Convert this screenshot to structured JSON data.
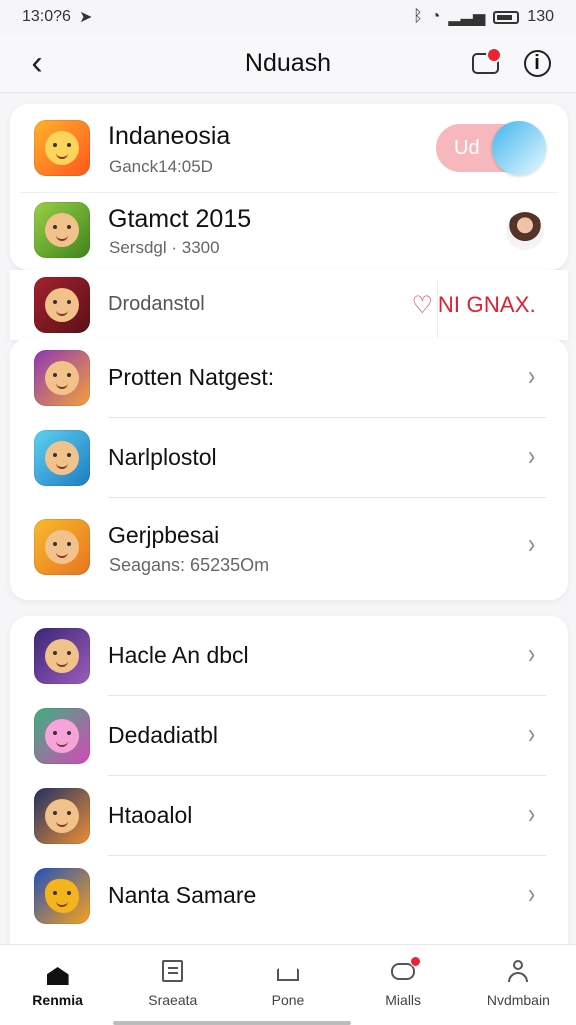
{
  "status_bar": {
    "time": "13:0?6",
    "right_time": "130"
  },
  "header": {
    "title": "Nduash"
  },
  "featured": [
    {
      "title": "Indaneosia",
      "subtitle": "Ganck14:05D",
      "pill": "Ud"
    },
    {
      "title": "Gtamct 2015",
      "subtitle": "Sersdgl · 3300"
    },
    {
      "title": "Drodanstol",
      "promo": "NI GNAX."
    }
  ],
  "card_one": [
    {
      "title": "Protten Natgest:"
    },
    {
      "title": "Narlplostol"
    },
    {
      "title": "Gerjpbesai",
      "subtitle": "Seagans: 65235Om"
    }
  ],
  "card_two": [
    {
      "title": "Hacle An dbcl"
    },
    {
      "title": "Dedadiatbl"
    },
    {
      "title": "Htaoalol"
    },
    {
      "title": "Nanta Samare"
    }
  ],
  "nav": [
    {
      "label": "Renmia",
      "active": true
    },
    {
      "label": "Sraeata"
    },
    {
      "label": "Pone"
    },
    {
      "label": "Mialls"
    },
    {
      "label": "Nvdmbain"
    }
  ],
  "colors": {
    "accent": "#e02030",
    "pill": "#f7b8bd",
    "background": "#f6f6f8"
  }
}
